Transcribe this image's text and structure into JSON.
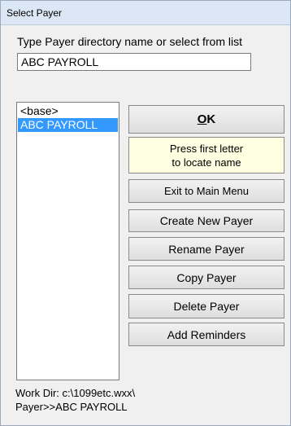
{
  "window": {
    "title": "Select Payer"
  },
  "prompt": {
    "text": "Type Payer directory name or select from list"
  },
  "name_input": {
    "value": "ABC PAYROLL"
  },
  "payer_list": {
    "items": [
      {
        "label": "<base>",
        "selected": false
      },
      {
        "label": "ABC PAYROLL",
        "selected": true
      }
    ]
  },
  "buttons": {
    "ok_mnemonic": "O",
    "ok_rest": "K",
    "exit": "Exit to Main Menu",
    "create": "Create New Payer",
    "rename": "Rename Payer",
    "copy": "Copy Payer",
    "delete": "Delete Payer",
    "reminders": "Add Reminders"
  },
  "hint": {
    "line1": "Press first letter",
    "line2": "to locate name"
  },
  "status": {
    "work_dir": "Work Dir: c:\\1099etc.wxx\\",
    "payer": "Payer>>ABC PAYROLL"
  }
}
